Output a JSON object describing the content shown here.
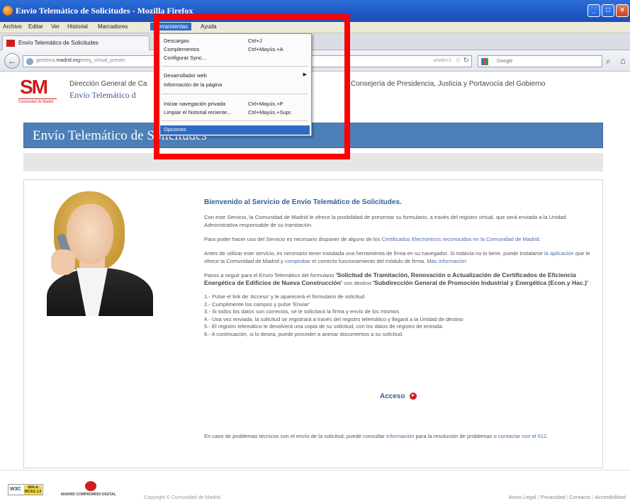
{
  "window": {
    "title": "Envío Telemático de Solicitudes - Mozilla Firefox",
    "buttons": [
      "_",
      "□",
      "×"
    ]
  },
  "menubar": {
    "items": [
      "Archivo",
      "Editar",
      "Ver",
      "Historial",
      "Marcadores",
      "Herramientas",
      "Ayuda"
    ],
    "active": "Herramientas"
  },
  "tab": {
    "label": "Envío Telemático de Solicitudes"
  },
  "navbar": {
    "url_prefix": "gestiona.",
    "url_domain": "madrid.org",
    "url_rest": "/ereg_virtual_presen",
    "url_tail": "ursdo=1",
    "search_placeholder": "Google"
  },
  "dropdown": {
    "items": [
      {
        "label": "Descargas",
        "shortcut": "Ctrl+J"
      },
      {
        "label": "Complementos",
        "shortcut": "Ctrl+Mayús.+A"
      },
      {
        "label": "Configurar Sync..."
      },
      {
        "label": "Desarrollador web",
        "submenu": true
      },
      {
        "label": "Información de la página"
      },
      {
        "label": "Iniciar navegación privada",
        "shortcut": "Ctrl+Mayús.+P"
      },
      {
        "label": "Limpiar el historial reciente...",
        "shortcut": "Ctrl+Mayús.+Supr."
      },
      {
        "label": "Opciones",
        "highlighted": true
      }
    ]
  },
  "header": {
    "logo_text": "SM",
    "logo_sub": "Comunidad de Madrid",
    "direccion": "Dirección General de Ca",
    "subtitle": "Envío Telemático d",
    "consejeria": "Consejería de Presidencia, Justicia y Portavocía del Gobierno"
  },
  "banner": {
    "title": "Envío Telemático de Solicitudes"
  },
  "content": {
    "welcome": "Bienvenido al Servicio de Envío Telemático de Solicitudes.",
    "p1": "Con este Servicio, la Comunidad de Madrid le ofrece la posibilidad de presentar su formulario, a través del registro virtual, que será enviada a la Unidad Administrativa responsable de su tramitación.",
    "p2_text": "Para poder hacer uso del Servicio es necesario disponer de alguno de los ",
    "p2_link": "Certificados Electrónicos reconocidos en la Comunidad de Madrid",
    "p2_end": ".",
    "p3_a": "Antes de utilizar este servicio, es necesario tener instalada una herramienta de firma en su navegador. Si todavía no lo tiene, puede instalarse ",
    "p3_link1": "la aplicación",
    "p3_b": " que le ofrece la Comunidad de Madrid y ",
    "p3_link2": "comprobar",
    "p3_c": " el correcto funcionamiento del módulo de firma. ",
    "p3_link3": "Más información",
    "p4_a": "Pasos a seguir para el Envío Telemático del formulario ",
    "p4_b": "'Solicitud de Tramitación, Renovación o Actualización de Certificados de Eficiencia Energética de Edificios de Nueva Construcción'",
    "p4_c": " con destino ",
    "p4_d": "'Subdirección General de Promoción Industrial y Energética (Econ.y Hac.)'",
    "p4_e": " :",
    "steps": [
      "1.- Pulse el link de 'Acceso' y le aparecerá el formulario de solicitud",
      "2.- Cumplimente los campos y pulse 'Enviar'",
      "3.- Si todos los datos son correctos, se le solicitará la firma y envío de los mismos",
      "4.- Una vez enviada, la solicitud se registrará a través del registro telemático y llegará a la Unidad de destino",
      "5.- El registro telemático le devolverá una copia de su solicitud, con los datos de registro de entrada.",
      "6.- A continuación, si lo desea, puede proceder a anexar documentos a su solicitud."
    ],
    "acceso": "Acceso",
    "problems_a": "En caso de problemas técnicos con el envío de la solicitud, puede consultar ",
    "problems_link1": "información",
    "problems_b": " para la resolución de problemas o ",
    "problems_link2": "contactar con el 012",
    "problems_c": "."
  },
  "footer": {
    "wai_w3c": "W3C",
    "wai_badge": "WAI-A WCAG 1.0",
    "mcd": "MADRID COMPROMISO DIGITAL",
    "copyright": "Copyright © Comunidad de Madrid.",
    "links": [
      "Aviso Legal",
      "Privacidad",
      "Contacto",
      "Accesibilidad"
    ]
  },
  "colors": {
    "accent": "#316ac5",
    "brand_red": "#d01c1c",
    "banner": "#4d7fb8",
    "annotation": "#ff0000"
  }
}
